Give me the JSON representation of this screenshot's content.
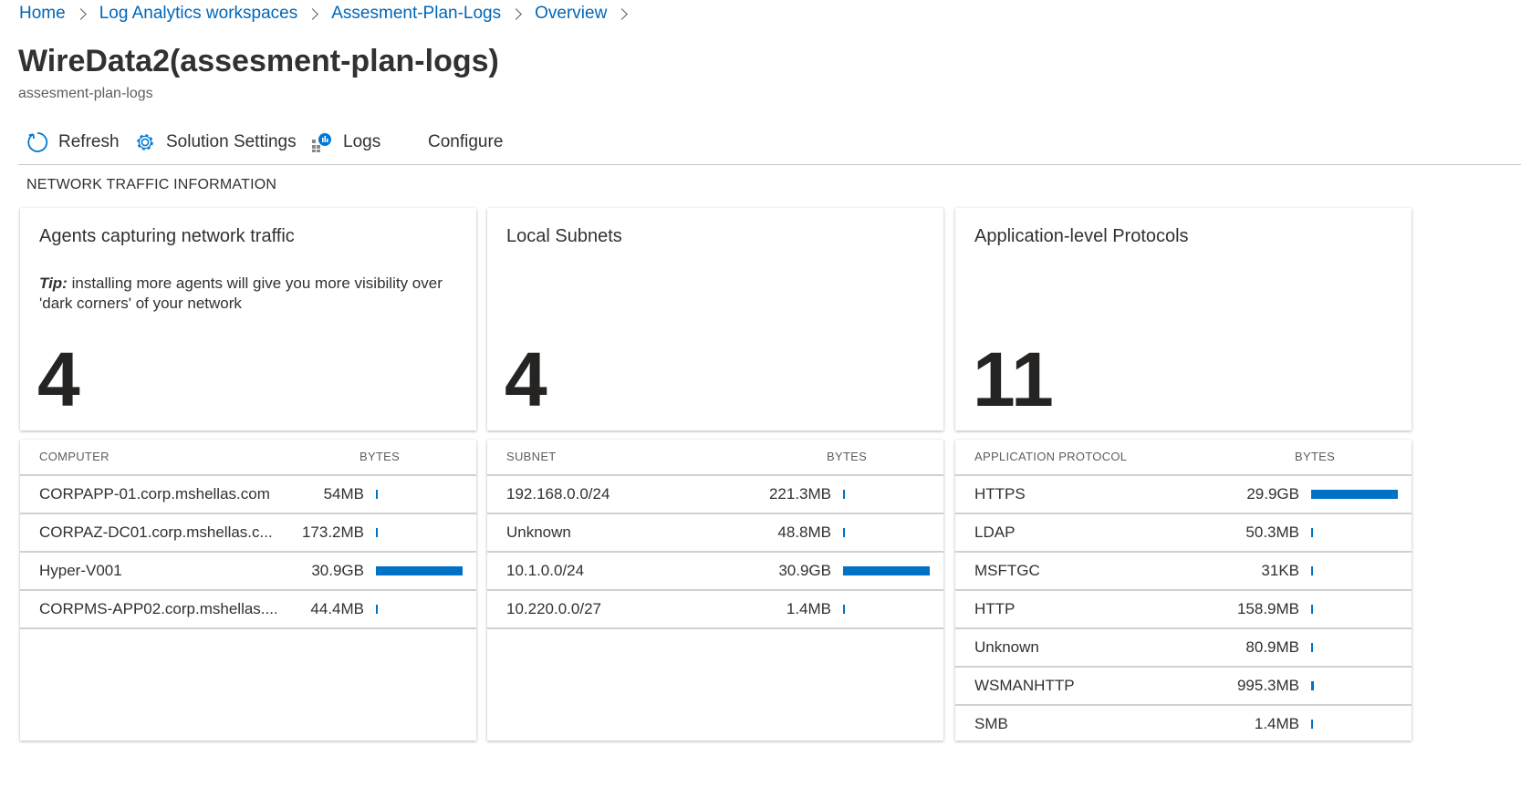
{
  "breadcrumb": [
    "Home",
    "Log Analytics workspaces",
    "Assesment-Plan-Logs",
    "Overview"
  ],
  "title": "WireData2(assesment-plan-logs)",
  "subtitle": "assesment-plan-logs",
  "toolbar": {
    "refresh_label": "Refresh",
    "settings_label": "Solution Settings",
    "logs_label": "Logs",
    "configure_label": "Configure"
  },
  "section_label": "NETWORK TRAFFIC INFORMATION",
  "accent_color": "#0072c6",
  "tiles": {
    "agents": {
      "title": "Agents capturing network traffic",
      "tip_label": "Tip:",
      "tip_text": "installing more agents will give you more visibility over 'dark corners' of your network",
      "count": "4"
    },
    "subnets": {
      "title": "Local Subnets",
      "count": "4"
    },
    "protocols": {
      "title": "Application-level Protocols",
      "count": "11"
    }
  },
  "tables": {
    "computers": {
      "header_name": "COMPUTER",
      "header_bytes": "BYTES",
      "rows": [
        {
          "name": "CORPAPP-01.corp.mshellas.com",
          "bytes": "54MB",
          "share": 0.0017
        },
        {
          "name": "CORPAZ-DC01.corp.mshellas.c...",
          "bytes": "173.2MB",
          "share": 0.0056
        },
        {
          "name": "Hyper-V001",
          "bytes": "30.9GB",
          "share": 1.0
        },
        {
          "name": "CORPMS-APP02.corp.mshellas....",
          "bytes": "44.4MB",
          "share": 0.0014
        }
      ]
    },
    "subnets": {
      "header_name": "SUBNET",
      "header_bytes": "BYTES",
      "rows": [
        {
          "name": "192.168.0.0/24",
          "bytes": "221.3MB",
          "share": 0.0072
        },
        {
          "name": "Unknown",
          "bytes": "48.8MB",
          "share": 0.0016
        },
        {
          "name": "10.1.0.0/24",
          "bytes": "30.9GB",
          "share": 1.0
        },
        {
          "name": "10.220.0.0/27",
          "bytes": "1.4MB",
          "share": 5e-05
        }
      ]
    },
    "protocols": {
      "header_name": "APPLICATION PROTOCOL",
      "header_bytes": "BYTES",
      "rows": [
        {
          "name": "HTTPS",
          "bytes": "29.9GB",
          "share": 1.0
        },
        {
          "name": "LDAP",
          "bytes": "50.3MB",
          "share": 0.0017
        },
        {
          "name": "MSFTGC",
          "bytes": "31KB",
          "share": 1e-06
        },
        {
          "name": "HTTP",
          "bytes": "158.9MB",
          "share": 0.0053
        },
        {
          "name": "Unknown",
          "bytes": "80.9MB",
          "share": 0.0027
        },
        {
          "name": "WSMANHTTP",
          "bytes": "995.3MB",
          "share": 0.0333
        },
        {
          "name": "SMB",
          "bytes": "1.4MB",
          "share": 5e-05
        }
      ]
    }
  }
}
